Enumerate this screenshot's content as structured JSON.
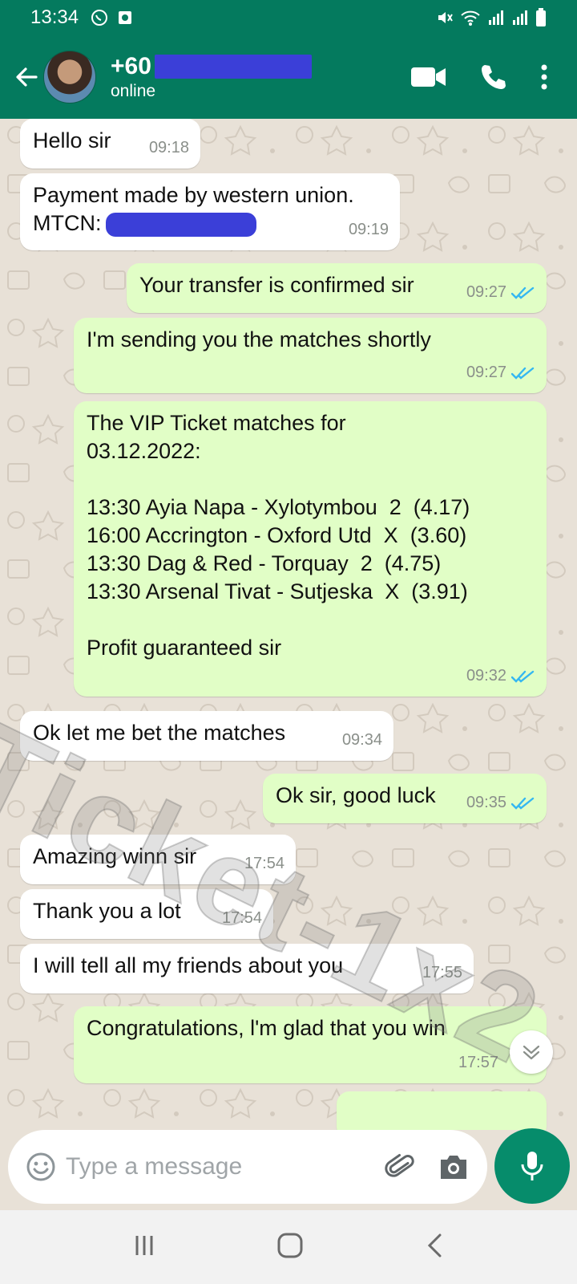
{
  "status_bar": {
    "time": "13:34"
  },
  "header": {
    "contact_name": "+60",
    "contact_status": "online"
  },
  "messages": [
    {
      "dir": "in",
      "text": "Hello sir",
      "time": "09:18"
    },
    {
      "dir": "in",
      "text": "Payment made by western union.",
      "text2": "MTCN:",
      "time": "09:19"
    },
    {
      "dir": "out",
      "text": "Your transfer is confirmed sir",
      "time": "09:27"
    },
    {
      "dir": "out",
      "text": "I'm sending you the matches shortly",
      "time": "09:27"
    },
    {
      "dir": "out",
      "text": "The VIP Ticket matches for\n03.12.2022:\n\n13:30 Ayia Napa - Xylotymbou  2  (4.17)\n16:00 Accrington - Oxford Utd  X  (3.60)\n13:30 Dag & Red - Torquay  2  (4.75)\n13:30 Arsenal Tivat - Sutjeska  X  (3.91)\n\nProfit guaranteed sir",
      "time": "09:32"
    },
    {
      "dir": "in",
      "text": "Ok let me bet the matches",
      "time": "09:34"
    },
    {
      "dir": "out",
      "text": "Ok sir, good luck",
      "time": "09:35"
    },
    {
      "dir": "in",
      "text": "Amazing winn sir",
      "time": "17:54"
    },
    {
      "dir": "in",
      "text": "Thank you a lot",
      "time": "17:54"
    },
    {
      "dir": "in",
      "text": "I will tell all my friends about you",
      "time": "17:55"
    },
    {
      "dir": "out",
      "text": "Congratulations, l'm glad that you win",
      "time": "17:57"
    }
  ],
  "watermark": "Ticket-1x2",
  "input": {
    "placeholder": "Type a message"
  },
  "colors": {
    "header": "#047a5e",
    "outgoing": "#e1fec6",
    "incoming": "#ffffff",
    "read_ticks": "#34b7f1",
    "mic": "#068c6b"
  },
  "icons": [
    "back-arrow-icon",
    "video-call-icon",
    "voice-call-icon",
    "more-options-icon",
    "emoji-icon",
    "attach-icon",
    "camera-icon",
    "mic-icon",
    "double-tick-icon",
    "scroll-down-icon"
  ]
}
